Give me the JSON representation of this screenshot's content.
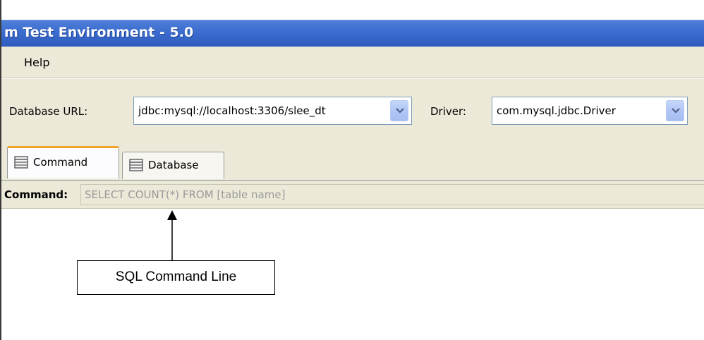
{
  "window": {
    "title": "m Test Environment - 5.0"
  },
  "menu": {
    "items": [
      {
        "label": "Help"
      }
    ]
  },
  "toolbar": {
    "database_url_label": "Database URL:",
    "database_url_value": "jdbc:mysql://localhost:3306/slee_dt",
    "driver_label": "Driver:",
    "driver_value": "com.mysql.jdbc.Driver"
  },
  "tabs": [
    {
      "label": "Command",
      "active": true,
      "icon": "table-icon"
    },
    {
      "label": "Database",
      "active": false,
      "icon": "table-icon"
    }
  ],
  "command": {
    "label": "Command:",
    "value": "",
    "placeholder": "SELECT COUNT(*) FROM [table name]"
  },
  "annotation": {
    "text": "SQL Command Line"
  },
  "colors": {
    "title_bar": "#3b6ccf",
    "chrome": "#ece9d8",
    "active_tab_accent": "#f0a328",
    "combo_button": "#b1c6f5"
  }
}
